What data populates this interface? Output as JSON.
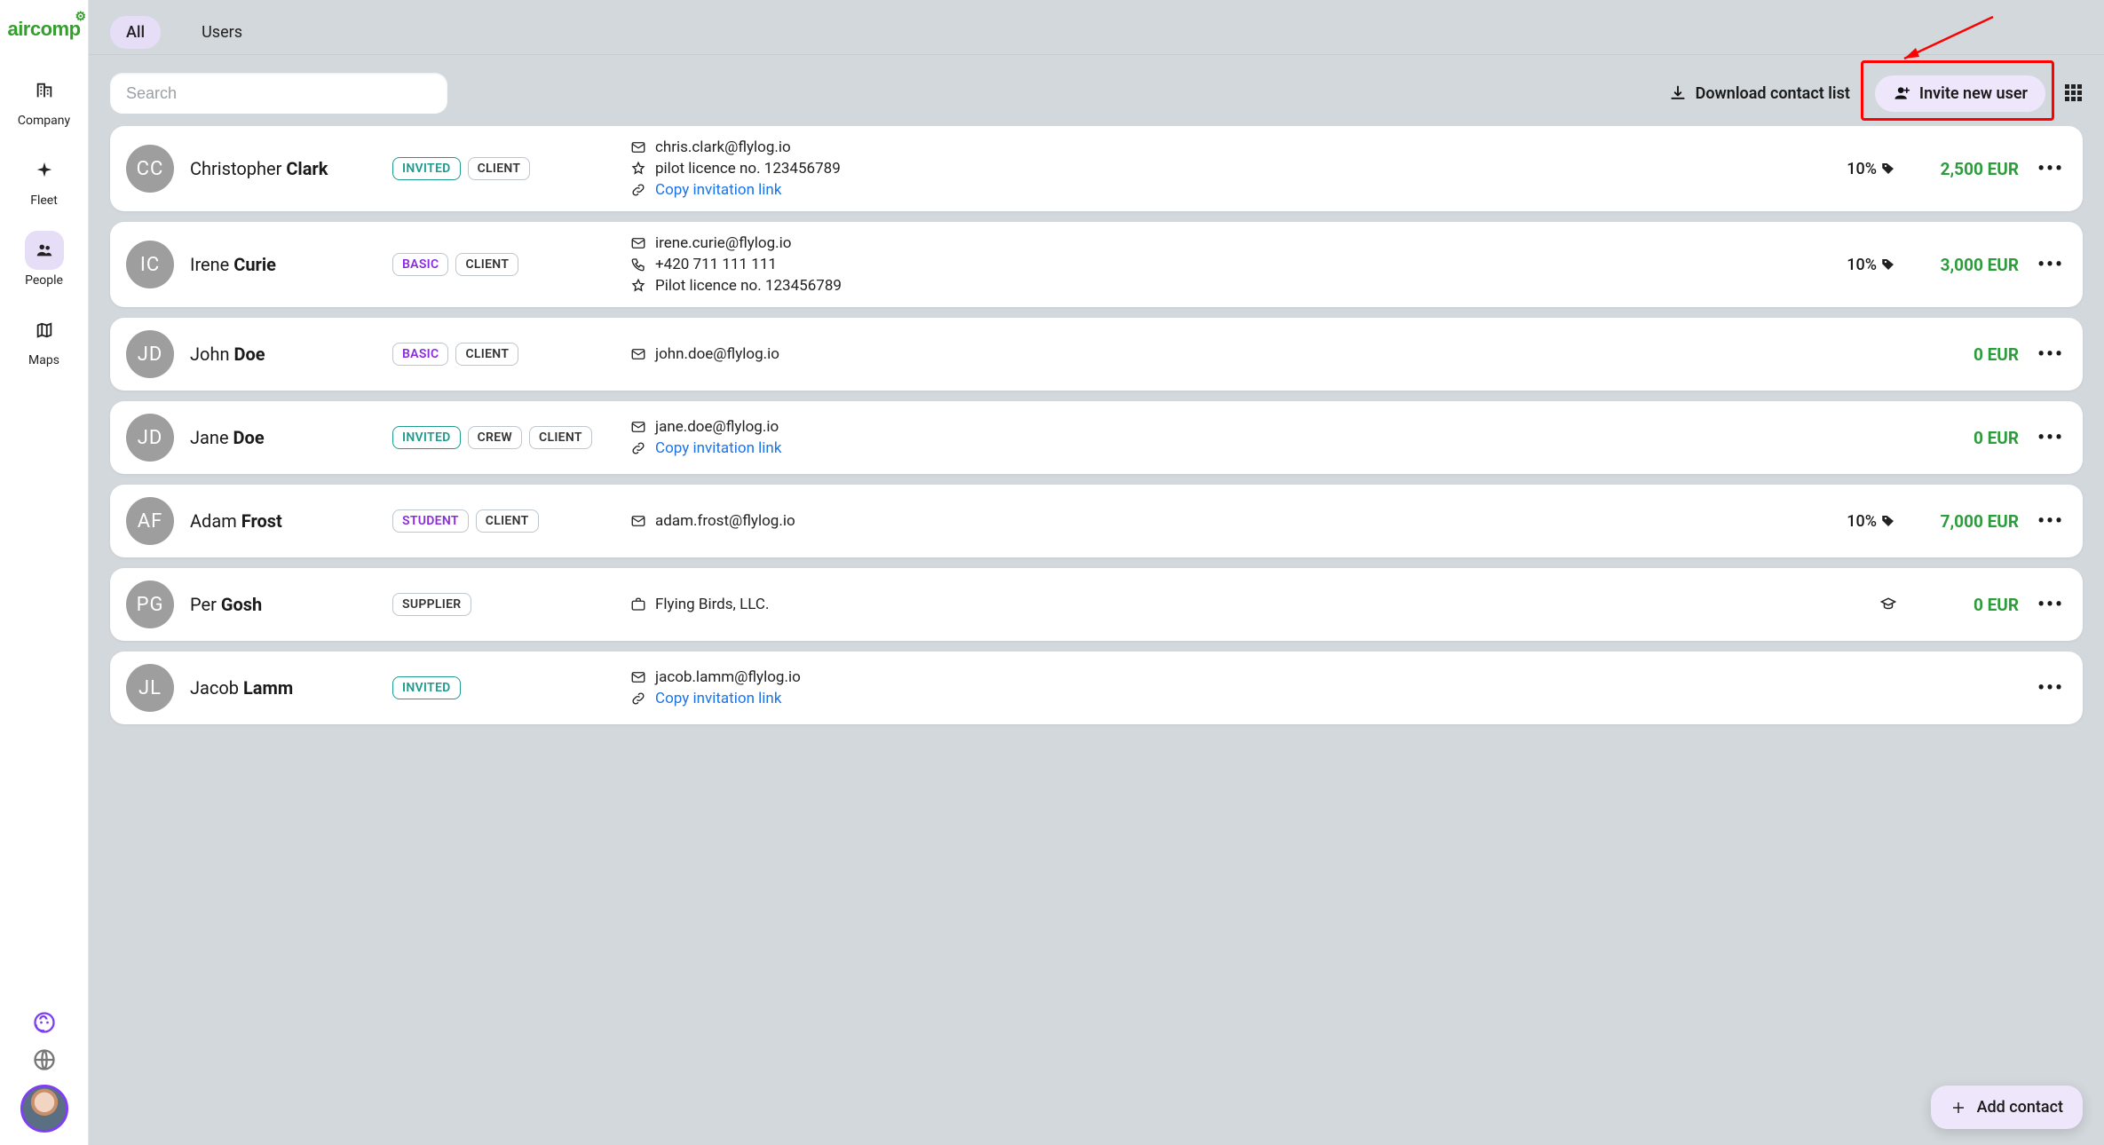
{
  "brand": "aircomp",
  "sidebar": {
    "items": [
      {
        "label": "Company",
        "name": "sidebar-item-company",
        "icon": "building-icon"
      },
      {
        "label": "Fleet",
        "name": "sidebar-item-fleet",
        "icon": "plane-icon"
      },
      {
        "label": "People",
        "name": "sidebar-item-people",
        "icon": "people-icon",
        "active": true
      },
      {
        "label": "Maps",
        "name": "sidebar-item-maps",
        "icon": "map-icon"
      }
    ],
    "support_icon": "headset-icon",
    "globe_icon": "globe-icon"
  },
  "tabs": [
    {
      "label": "All",
      "active": true
    },
    {
      "label": "Users",
      "active": false
    }
  ],
  "search_placeholder": "Search",
  "toolbar": {
    "download_label": "Download contact list",
    "invite_label": "Invite new user"
  },
  "fab_label": "Add contact",
  "copy_link_label": "Copy invitation link",
  "people": [
    {
      "initials": "CC",
      "first": "Christopher",
      "last": "Clark",
      "tags": [
        {
          "text": "INVITED",
          "style": "invited"
        },
        {
          "text": "CLIENT",
          "style": "client"
        }
      ],
      "details": [
        {
          "icon": "mail",
          "text": "chris.clark@flylog.io"
        },
        {
          "icon": "star",
          "text": "pilot licence no. 123456789"
        },
        {
          "icon": "link",
          "text": "Copy invitation link",
          "link": true
        }
      ],
      "pct": "10%",
      "pct_icon": "tag",
      "amount": "2,500 EUR"
    },
    {
      "initials": "IC",
      "first": "Irene",
      "last": "Curie",
      "tags": [
        {
          "text": "BASIC",
          "style": "basic"
        },
        {
          "text": "CLIENT",
          "style": "client"
        }
      ],
      "details": [
        {
          "icon": "mail",
          "text": "irene.curie@flylog.io"
        },
        {
          "icon": "phone",
          "text": "+420 711 111 111"
        },
        {
          "icon": "star",
          "text": "Pilot licence no. 123456789"
        }
      ],
      "pct": "10%",
      "pct_icon": "tag",
      "amount": "3,000 EUR"
    },
    {
      "initials": "JD",
      "first": "John",
      "last": "Doe",
      "tags": [
        {
          "text": "BASIC",
          "style": "basic"
        },
        {
          "text": "CLIENT",
          "style": "client"
        }
      ],
      "details": [
        {
          "icon": "mail",
          "text": "john.doe@flylog.io"
        }
      ],
      "pct": "",
      "amount": "0 EUR"
    },
    {
      "initials": "JD",
      "first": "Jane",
      "last": "Doe",
      "tags": [
        {
          "text": "INVITED",
          "style": "invited"
        },
        {
          "text": "CREW",
          "style": "crew"
        },
        {
          "text": "CLIENT",
          "style": "client"
        }
      ],
      "details": [
        {
          "icon": "mail",
          "text": "jane.doe@flylog.io"
        },
        {
          "icon": "link",
          "text": "Copy invitation link",
          "link": true
        }
      ],
      "pct": "",
      "amount": "0 EUR"
    },
    {
      "initials": "AF",
      "first": "Adam",
      "last": "Frost",
      "tags": [
        {
          "text": "STUDENT",
          "style": "student"
        },
        {
          "text": "CLIENT",
          "style": "client"
        }
      ],
      "details": [
        {
          "icon": "mail",
          "text": "adam.frost@flylog.io"
        }
      ],
      "pct": "10%",
      "pct_icon": "tag",
      "amount": "7,000 EUR"
    },
    {
      "initials": "PG",
      "first": "Per",
      "last": "Gosh",
      "tags": [
        {
          "text": "SUPPLIER",
          "style": "supplier"
        }
      ],
      "details": [
        {
          "icon": "briefcase",
          "text": "Flying Birds, LLC."
        }
      ],
      "pct": "",
      "pct_icon": "grad",
      "amount": "0 EUR"
    },
    {
      "initials": "JL",
      "first": "Jacob",
      "last": "Lamm",
      "tags": [
        {
          "text": "INVITED",
          "style": "invited"
        }
      ],
      "details": [
        {
          "icon": "mail",
          "text": "jacob.lamm@flylog.io"
        },
        {
          "icon": "link",
          "text": "Copy invitation link",
          "link": true
        }
      ],
      "pct": "",
      "amount": ""
    }
  ]
}
